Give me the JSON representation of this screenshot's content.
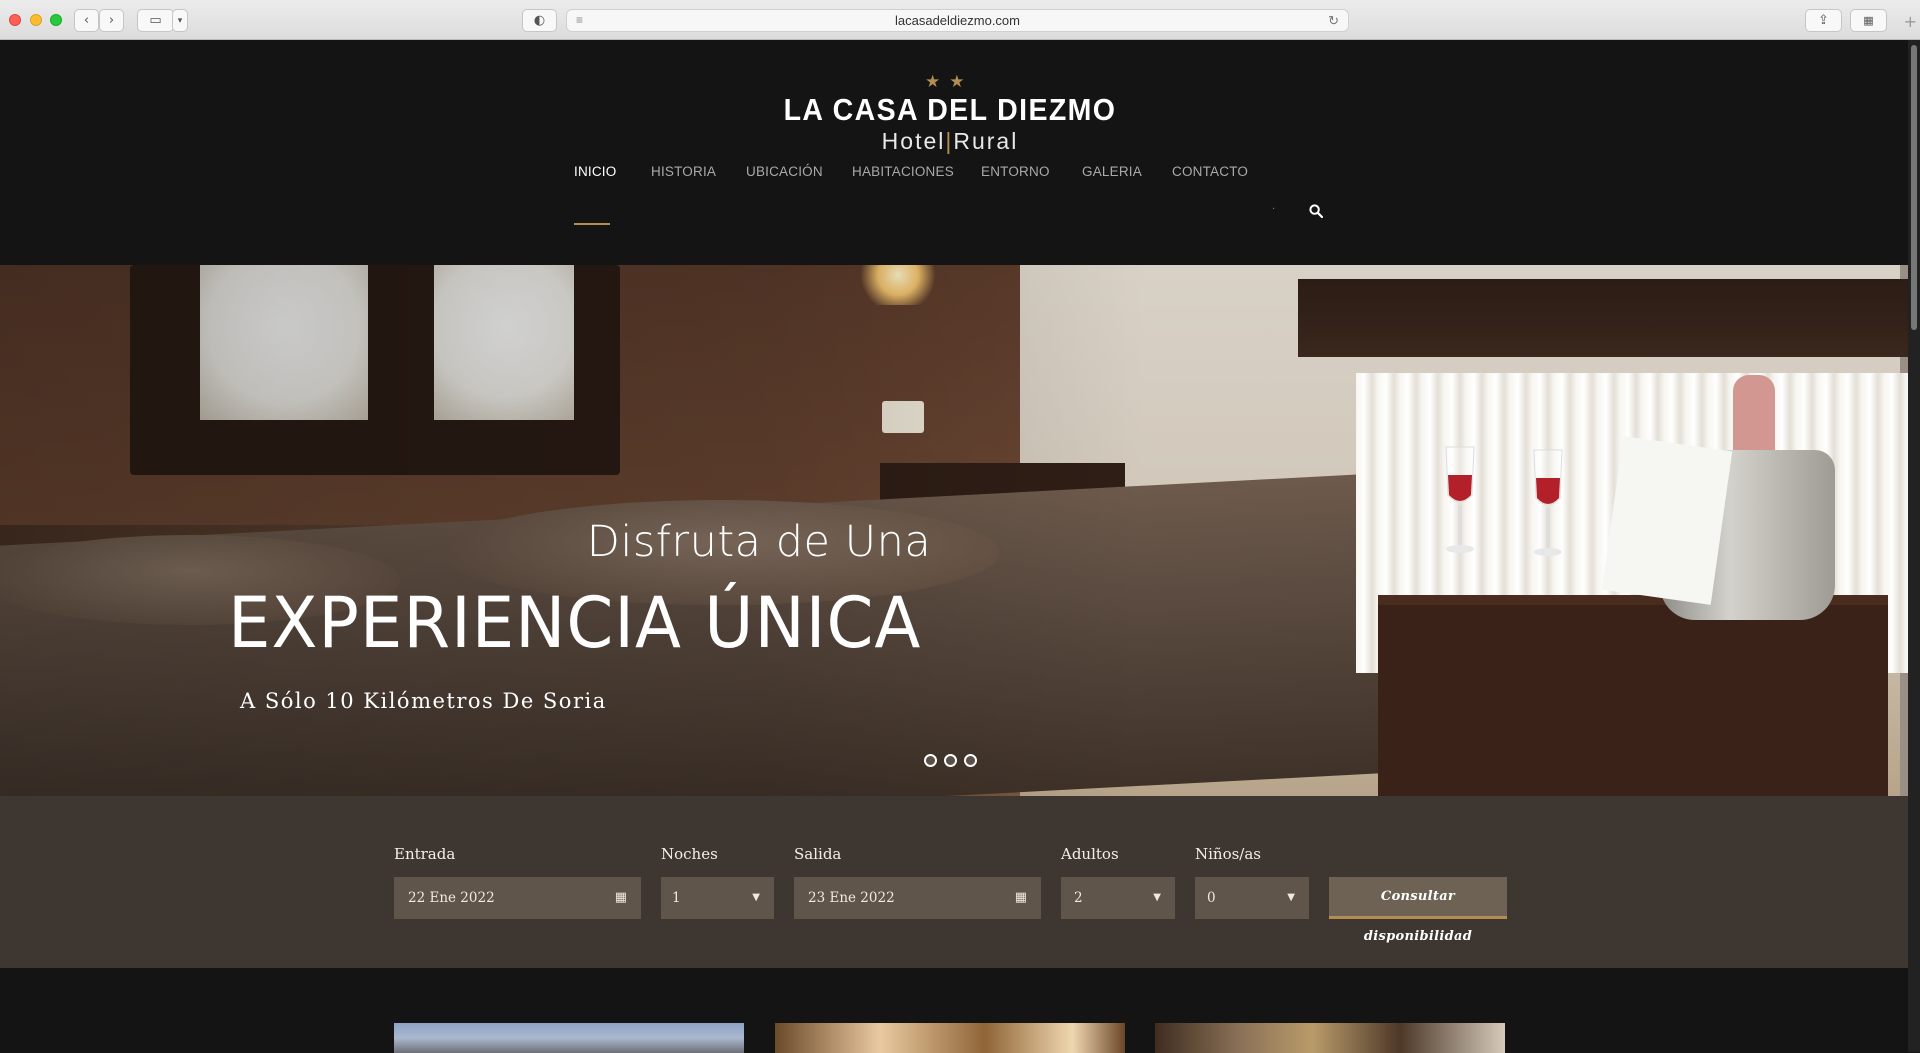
{
  "browser": {
    "url": "lacasadeldiezmo.com"
  },
  "site": {
    "logo_title": "LA CASA DEL DIEZMO",
    "logo_sub_left": "Hotel",
    "logo_sub_right": "Rural",
    "stars": "★★",
    "accent_color": "#b28e52"
  },
  "nav": {
    "items": [
      {
        "label": "INICIO",
        "active": true
      },
      {
        "label": "HISTORIA"
      },
      {
        "label": "UBICACIÓN"
      },
      {
        "label": "HABITACIONES"
      },
      {
        "label": "ENTORNO"
      },
      {
        "label": "GALERIA"
      },
      {
        "label": "CONTACTO"
      }
    ],
    "separator": "·",
    "search_icon": "search-icon"
  },
  "hero": {
    "line1": "Disfruta de Una",
    "line2": "EXPERIENCIA ÚNICA",
    "line3": "A Sólo 10 Kilómetros De Soria",
    "slides": 3
  },
  "booking": {
    "entrada_label": "Entrada",
    "entrada_value": "22 Ene 2022",
    "noches_label": "Noches",
    "noches_value": "1",
    "salida_label": "Salida",
    "salida_value": "23 Ene 2022",
    "adultos_label": "Adultos",
    "adultos_value": "2",
    "ninos_label": "Niños/as",
    "ninos_value": "0",
    "button_label": "Consultar disponibilidad",
    "calendar_icon": "calendar-icon",
    "dropdown_icon": "caret-down-icon"
  }
}
